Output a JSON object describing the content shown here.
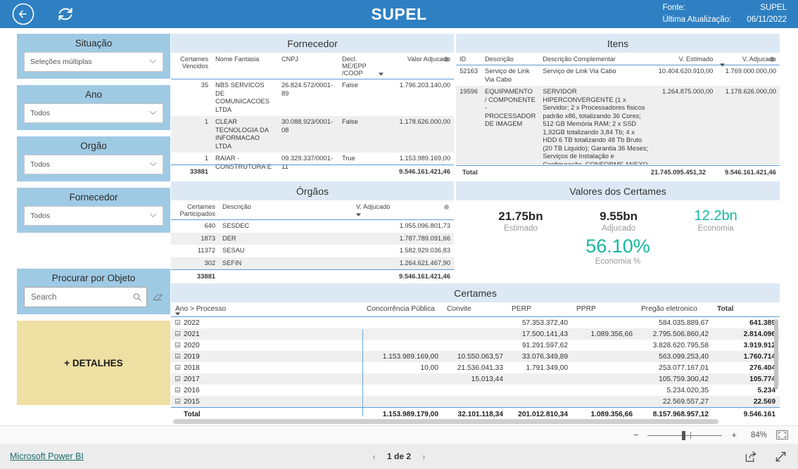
{
  "header": {
    "title": "SUPEL",
    "back_icon": "back-arrow-circle-icon",
    "refresh_icon": "refresh-icon",
    "source_label": "Fonte:",
    "source_value": "SUPEL",
    "updated_label": "Última Atualização:",
    "updated_value": "06/11/2022",
    "bar_color": "#2e80c2"
  },
  "sidebar": {
    "filters": [
      {
        "title": "Situação",
        "value": "Seleções múltiplas"
      },
      {
        "title": "Ano",
        "value": "Todos"
      },
      {
        "title": "Orgão",
        "value": "Todos"
      },
      {
        "title": "Fornecedor",
        "value": "Todos"
      }
    ],
    "search": {
      "title": "Procurar por Objeto",
      "placeholder": "Search",
      "value": ""
    },
    "details_button": "+ DETALHES"
  },
  "fornecedor": {
    "title": "Fornecedor",
    "columns": [
      "Certames Vencidos",
      "Nome Fantasia",
      "CNPJ",
      "Decl. ME/EPP /COOP",
      "Valor Adjucado"
    ],
    "rows": [
      {
        "certames": "35",
        "nome": "NBS SERVICOS DE COMUNICACOES LTDA",
        "cnpj": "26.824.572/0001-89",
        "decl": "False",
        "valor": "1.796.203.140,00"
      },
      {
        "certames": "1",
        "nome": "CLEAR TECNOLOGIA DA INFORMACAO LTDA",
        "cnpj": "30.088.923/0001-08",
        "decl": "False",
        "valor": "1.178.626.000,00"
      },
      {
        "certames": "1",
        "nome": "RAIAR - CONSTRUTORA E",
        "cnpj": "09.329.337/0001-11",
        "decl": "True",
        "valor": "1.153.989.169,00"
      }
    ],
    "total": {
      "certames": "33881",
      "valor": "9.546.161.421,46"
    }
  },
  "itens": {
    "title": "Itens",
    "columns": [
      "ID",
      "Descrição",
      "Descrição Complementar",
      "V. Estimado",
      "V. Adjucado"
    ],
    "rows": [
      {
        "id": "52163",
        "descricao": "Serviço de Link Via Cabo",
        "complementar": "Serviço de Link Via Cabo",
        "estimado": "10.404.620.910,00",
        "adjucado": "1.769.000.000,00"
      },
      {
        "id": "19596",
        "descricao": "EQUIPAMENTO / COMPONENTE - PROCESSADOR DE IMAGEM",
        "complementar": "SERVIDOR HIPERCONVERGENTE (1 x Servidor; 2 x Processadores fisicos padrão x86, totalizando 36 Cores; 512 GB Memória RAM; 2 x SSD 1,92GB totalizando 3,84 Tb; 4 x HDD 6 TB totalizando 48 Tb Bruto (20 TB Liquido); Garantia 36 Meses; Serviços de Instalação e Configuração. CONFORME ANEXO I DO EDITAL",
        "estimado": "1.264.875.000,00",
        "adjucado": "1.178.626.000,00"
      }
    ],
    "total": {
      "label": "Total",
      "estimado": "21.745.095.451,32",
      "adjucado": "9.546.161.421,46"
    }
  },
  "orgaos": {
    "title": "Órgãos",
    "columns": [
      "Certames Participados",
      "Descrição",
      "V. Adjucado"
    ],
    "rows": [
      {
        "certames": "640",
        "descricao": "SESDEC",
        "valor": "1.955.096.801,73"
      },
      {
        "certames": "1873",
        "descricao": "DER",
        "valor": "1.787.789.091,66"
      },
      {
        "certames": "11372",
        "descricao": "SESAU",
        "valor": "1.582.929.036,83"
      },
      {
        "certames": "302",
        "descricao": "SEFIN",
        "valor": "1.264.621.467,90"
      }
    ],
    "total": {
      "certames": "33881",
      "valor": "9.546.161.421,46"
    }
  },
  "valores": {
    "title": "Valores dos Certames",
    "accent_color": "#15b8a0",
    "kpis": [
      {
        "value": "21.75bn",
        "label": "Estimado",
        "accent": false
      },
      {
        "value": "9.55bn",
        "label": "Adjucado",
        "accent": false
      },
      {
        "value": "12.2bn",
        "label": "Economia",
        "accent": true
      }
    ],
    "highlight": {
      "value": "56.10%",
      "label": "Economia %"
    }
  },
  "certames": {
    "title": "Certames",
    "row_header": "Ano > Processo",
    "columns": [
      "Concorrência Pública",
      "Convite",
      "PERP",
      "PPRP",
      "Pregão eletronico",
      "Total"
    ],
    "rows": [
      {
        "ano": "2022",
        "concorrencia": "",
        "convite": "",
        "perp": "57.353.372,40",
        "pprp": "",
        "pregao": "584.035.889,67",
        "total": "641.389"
      },
      {
        "ano": "2021",
        "concorrencia": "",
        "convite": "",
        "perp": "17.500.141,43",
        "pprp": "1.089.356,66",
        "pregao": "2.795.506.860,42",
        "total": "2.814.096"
      },
      {
        "ano": "2020",
        "concorrencia": "",
        "convite": "",
        "perp": "91.291.597,62",
        "pprp": "",
        "pregao": "3.828.620.795,58",
        "total": "3.919.912"
      },
      {
        "ano": "2019",
        "concorrencia": "1.153.989.169,00",
        "convite": "10.550.063,57",
        "perp": "33.076.349,89",
        "pprp": "",
        "pregao": "563.099.253,40",
        "total": "1.760.714"
      },
      {
        "ano": "2018",
        "concorrencia": "10,00",
        "convite": "21.536.041,33",
        "perp": "1.791.349,00",
        "pprp": "",
        "pregao": "253.077.167,01",
        "total": "276.404"
      },
      {
        "ano": "2017",
        "concorrencia": "",
        "convite": "15.013,44",
        "perp": "",
        "pprp": "",
        "pregao": "105.759.300,42",
        "total": "105.774"
      },
      {
        "ano": "2016",
        "concorrencia": "",
        "convite": "",
        "perp": "",
        "pprp": "",
        "pregao": "5.234.020,35",
        "total": "5.234"
      },
      {
        "ano": "2015",
        "concorrencia": "",
        "convite": "",
        "perp": "",
        "pprp": "",
        "pregao": "22.569.557,27",
        "total": "22.569"
      }
    ],
    "total": {
      "label": "Total",
      "concorrencia": "1.153.989.179,00",
      "convite": "32.101.118,34",
      "perp": "201.012.810,34",
      "pprp": "1.089.356,66",
      "pregao": "8.157.968.957,12",
      "total": "9.546.161"
    }
  },
  "statusbar": {
    "zoom_minus": "−",
    "zoom_plus": "+",
    "zoom_level": "84%",
    "fit_icon": "fit-to-page-icon"
  },
  "footer": {
    "brand_link": "Microsoft Power BI",
    "prev_icon": "chevron-left-icon",
    "next_icon": "chevron-right-icon",
    "page_label": "1 de 2",
    "share_icon": "share-icon",
    "fullscreen_icon": "fullscreen-icon"
  }
}
